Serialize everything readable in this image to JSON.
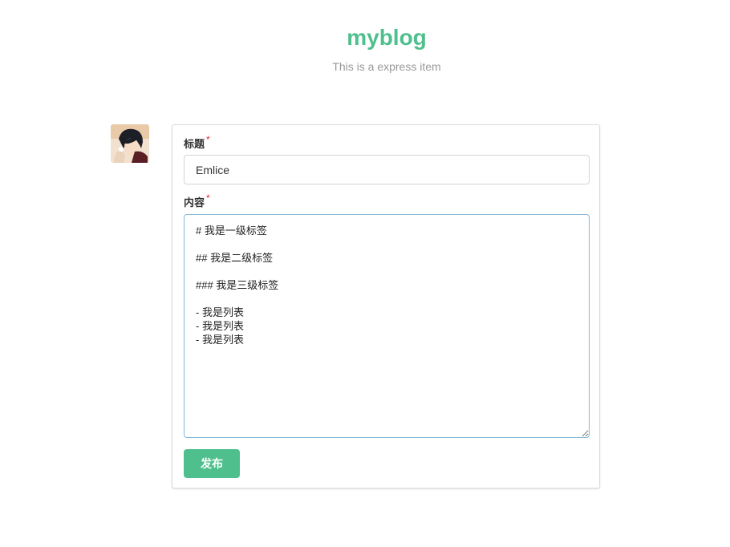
{
  "header": {
    "title": "myblog",
    "subtitle": "This is a express item"
  },
  "colors": {
    "accent": "#4fc08d",
    "required": "#db2828",
    "focus_border": "#85b7d9"
  },
  "form": {
    "title_label": "标题",
    "title_value": "Emlice",
    "content_label": "内容",
    "content_value": "# 我是一级标签\n\n## 我是二级标签\n\n### 我是三级标签\n\n- 我是列表\n- 我是列表\n- 我是列表",
    "required_marker": "*",
    "publish_label": "发布"
  }
}
